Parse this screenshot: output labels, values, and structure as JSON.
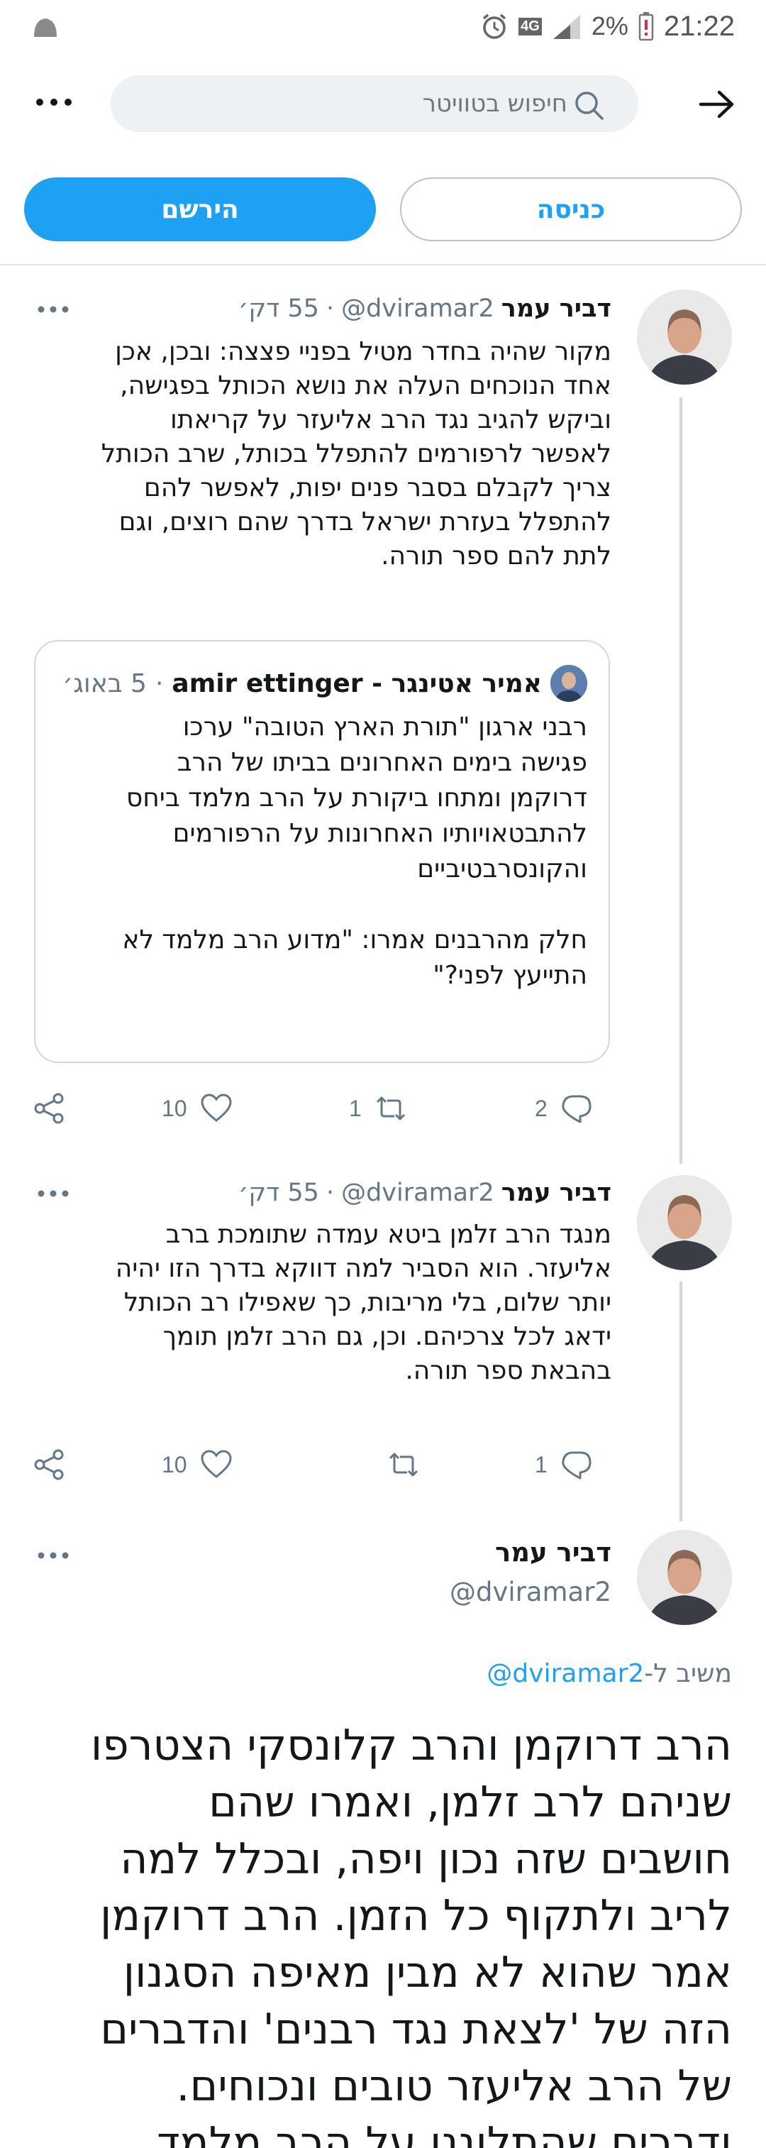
{
  "status_bar": {
    "time": "21:22",
    "battery": "2%",
    "network": "4G"
  },
  "search": {
    "placeholder": "חיפוש בטוויטר"
  },
  "auth": {
    "login_label": "כניסה",
    "signup_label": "הירשם"
  },
  "colors": {
    "accent": "#1da1f2",
    "muted": "#657786",
    "border": "#cfd9de"
  },
  "tweets": [
    {
      "name": "דביר עמר",
      "handle": "@dviramar2",
      "time": "55 דק׳",
      "text": "מקור שהיה בחדר מטיל בפניי פצצה: ובכן, אכן\nאחד הנוכחים העלה את נושא הכותל בפגישה,\nוביקש להגיב נגד הרב אליעזר על קריאתו\nלאפשר לרפורמים להתפלל בכותל, שרב הכותל\nצריך לקבלם בסבר פנים יפות, לאפשר להם\nלהתפלל בעזרת ישראל בדרך שהם רוצים, וגם\nלתת להם ספר תורה.",
      "quote": {
        "name": "אמיר אטינגר - amir ettinger",
        "time": "5 באוג׳",
        "text": "רבני ארגון \"תורת הארץ הטובה\" ערכו\nפגישה בימים האחרונים בביתו של הרב\nדרוקמן ומתחו ביקורת על הרב מלמד ביחס\nלהתבטאויותיו האחרונות על הרפורמים\nוהקונסרבטיביים\n\nחלק מהרבנים אמרו: \"מדוע הרב מלמד לא\nהתייעץ לפני?\""
      },
      "replies": "2",
      "retweets": "1",
      "likes": "10"
    },
    {
      "name": "דביר עמר",
      "handle": "@dviramar2",
      "time": "55 דק׳",
      "text": "מנגד הרב זלמן ביטא עמדה שתומכת ברב\nאליעזר. הוא הסביר למה דווקא בדרך הזו יהיה\nיותר שלום, בלי מריבות, כך שאפילו רב הכותל\nידאג לכל צרכיהם. וכן, גם הרב זלמן תומך\nבהבאת ספר תורה.",
      "replies": "1",
      "retweets": "",
      "likes": "10"
    }
  ],
  "main_tweet": {
    "name": "דביר עמר",
    "handle": "@dviramar2",
    "reply_prefix": "משיב ל-",
    "reply_to": "@dviramar2",
    "text": "הרב דרוקמן והרב קלונסקי הצטרפו\nשניהם לרב זלמן, ואמרו שהם\nחושבים שזה נכון ויפה, ובכלל למה\nלריב ולתקוף כל הזמן. הרב דרוקמן\nאמר שהוא לא מבין מאיפה הסגנון\nהזה של 'לצאת נגד רבנים' והדברים\nשל הרב אליעזר טובים ונכוחים.\nודברים שהתלוננו על הרב מלמד"
  }
}
